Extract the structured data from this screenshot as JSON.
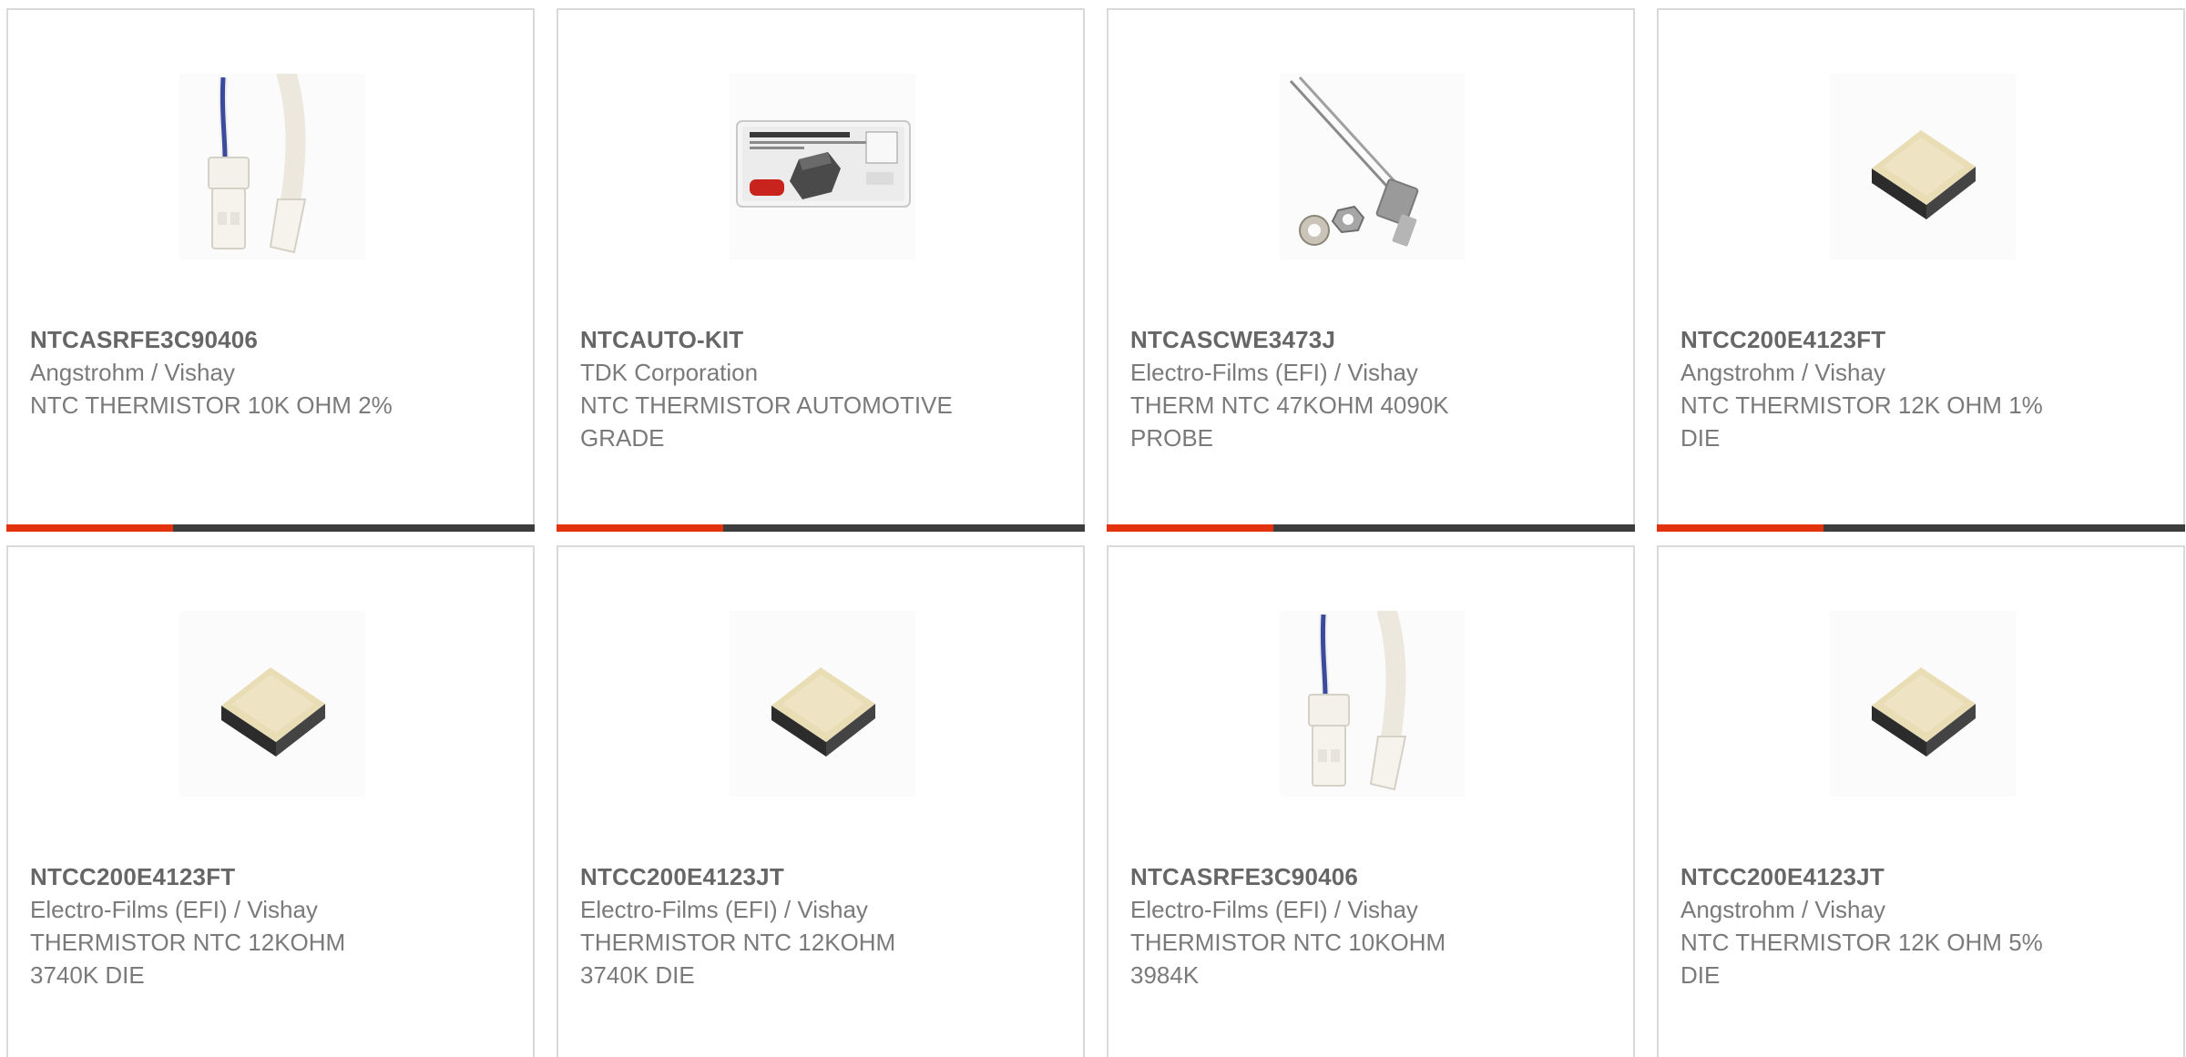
{
  "products": [
    {
      "part_number": "NTCASRFE3C90406",
      "manufacturer": "Angstrohm / Vishay",
      "description": "NTC THERMISTOR 10K OHM 2%",
      "image": "cable-connector-probe-image"
    },
    {
      "part_number": "NTCAUTO-KIT",
      "manufacturer": "TDK Corporation",
      "description": "NTC THERMISTOR AUTOMOTIVE GRADE",
      "image": "kit-box-image"
    },
    {
      "part_number": "NTCASCWE3473J",
      "manufacturer": "Electro-Films (EFI) / Vishay",
      "description": "THERM NTC 47KOHM 4090K PROBE",
      "image": "screw-probe-image"
    },
    {
      "part_number": "NTCC200E4123FT",
      "manufacturer": "Angstrohm / Vishay",
      "description": "NTC THERMISTOR 12K OHM 1% DIE",
      "image": "die-chip-image"
    },
    {
      "part_number": "NTCC200E4123FT",
      "manufacturer": "Electro-Films (EFI) / Vishay",
      "description": "THERMISTOR NTC 12KOHM 3740K DIE",
      "image": "die-chip-image"
    },
    {
      "part_number": "NTCC200E4123JT",
      "manufacturer": "Electro-Films (EFI) / Vishay",
      "description": "THERMISTOR NTC 12KOHM 3740K DIE",
      "image": "die-chip-image"
    },
    {
      "part_number": "NTCASRFE3C90406",
      "manufacturer": "Electro-Films (EFI) / Vishay",
      "description": "THERMISTOR NTC 10KOHM 3984K",
      "image": "cable-connector-probe-image"
    },
    {
      "part_number": "NTCC200E4123JT",
      "manufacturer": "Angstrohm / Vishay",
      "description": "NTC THERMISTOR 12K OHM 5% DIE",
      "image": "die-chip-image"
    }
  ],
  "colors": {
    "accent": "#e2320e",
    "bar": "#3d3d3d",
    "border": "#d9d9d9",
    "part_text": "#666666",
    "body_text": "#7a7a7a"
  }
}
